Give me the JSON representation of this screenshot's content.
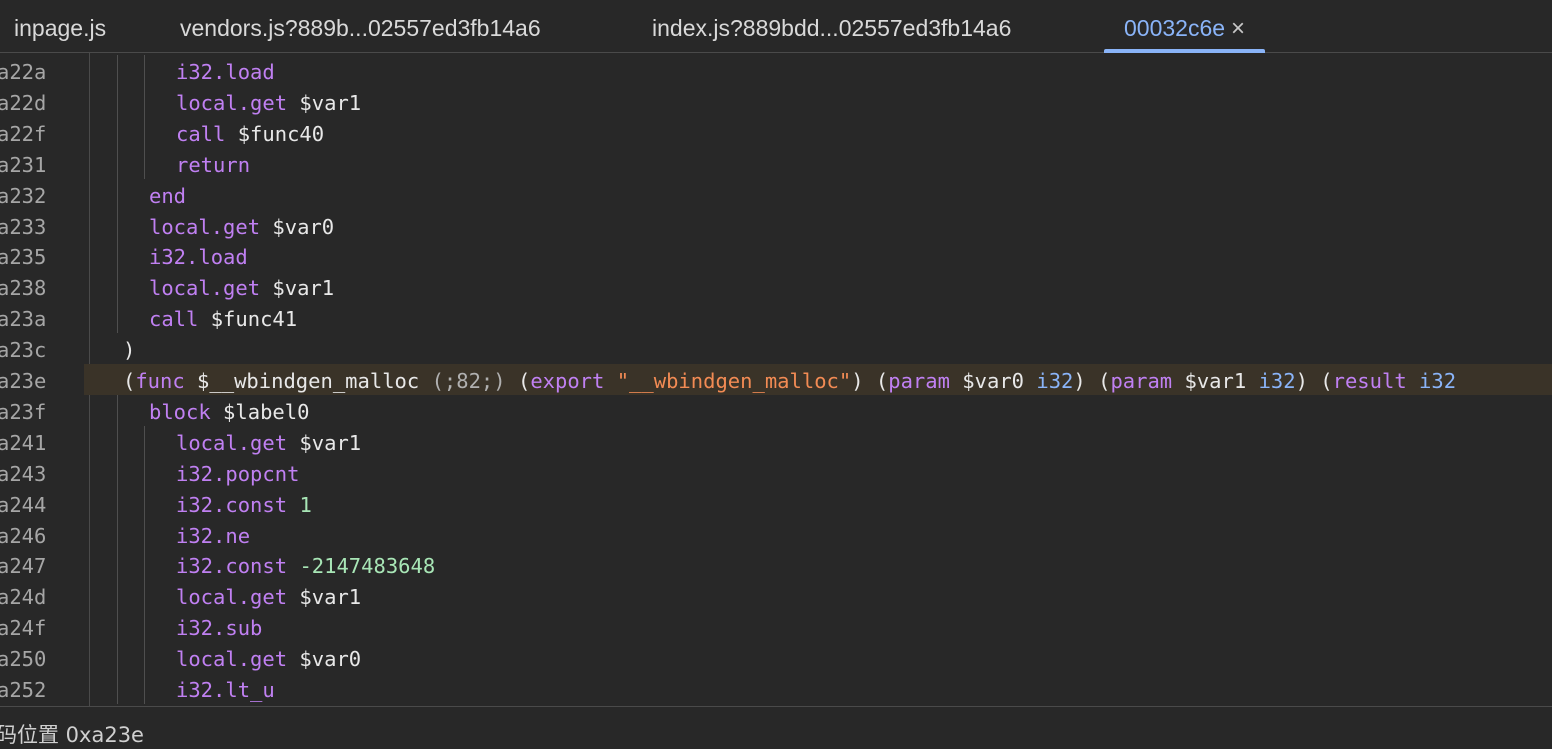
{
  "tabs": [
    {
      "label": "inpage.js",
      "active": false
    },
    {
      "label": "vendors.js?889b...02557ed3fb14a6",
      "active": false
    },
    {
      "label": "index.js?889bdd...02557ed3fb14a6",
      "active": false
    },
    {
      "label": "00032c6e",
      "active": true
    }
  ],
  "tab_close_icon": "×",
  "lines": [
    {
      "addr": "a22a",
      "tokens": [
        [
          "kw",
          "i32.load"
        ]
      ]
    },
    {
      "addr": "a22d",
      "tokens": [
        [
          "kw",
          "local.get"
        ],
        [
          "var",
          " $var1"
        ]
      ]
    },
    {
      "addr": "a22f",
      "tokens": [
        [
          "kw",
          "call"
        ],
        [
          "var",
          " $func40"
        ]
      ]
    },
    {
      "addr": "a231",
      "tokens": [
        [
          "kw",
          "return"
        ]
      ]
    },
    {
      "addr": "a232",
      "tokens": [
        [
          "kw",
          "end"
        ]
      ]
    },
    {
      "addr": "a233",
      "tokens": [
        [
          "kw",
          "local.get"
        ],
        [
          "var",
          " $var0"
        ]
      ]
    },
    {
      "addr": "a235",
      "tokens": [
        [
          "kw",
          "i32.load"
        ]
      ]
    },
    {
      "addr": "a238",
      "tokens": [
        [
          "kw",
          "local.get"
        ],
        [
          "var",
          " $var1"
        ]
      ]
    },
    {
      "addr": "a23a",
      "tokens": [
        [
          "kw",
          "call"
        ],
        [
          "var",
          " $func41"
        ]
      ]
    },
    {
      "addr": "a23c",
      "tokens": [
        [
          "punc",
          ")"
        ]
      ]
    },
    {
      "addr": "a23e",
      "tokens": [
        [
          "punc",
          "("
        ],
        [
          "kw",
          "func"
        ],
        [
          "var",
          " $__wbindgen_malloc "
        ],
        [
          "cmt",
          "(;82;)"
        ],
        [
          "punc",
          " ("
        ],
        [
          "kw",
          "export"
        ],
        [
          "punc",
          " "
        ],
        [
          "str",
          "\"__wbindgen_malloc\""
        ],
        [
          "punc",
          ") ("
        ],
        [
          "kw",
          "param"
        ],
        [
          "var",
          " $var0 "
        ],
        [
          "type",
          "i32"
        ],
        [
          "punc",
          ") ("
        ],
        [
          "kw",
          "param"
        ],
        [
          "var",
          " $var1 "
        ],
        [
          "type",
          "i32"
        ],
        [
          "punc",
          ") ("
        ],
        [
          "kw",
          "result"
        ],
        [
          "punc",
          " "
        ],
        [
          "type",
          "i32"
        ]
      ]
    },
    {
      "addr": "a23f",
      "tokens": [
        [
          "kw",
          "block"
        ],
        [
          "var",
          " $label0"
        ]
      ]
    },
    {
      "addr": "a241",
      "tokens": [
        [
          "kw",
          "local.get"
        ],
        [
          "var",
          " $var1"
        ]
      ]
    },
    {
      "addr": "a243",
      "tokens": [
        [
          "kw",
          "i32.popcnt"
        ]
      ]
    },
    {
      "addr": "a244",
      "tokens": [
        [
          "kw",
          "i32.const"
        ],
        [
          "punc",
          " "
        ],
        [
          "num",
          "1"
        ]
      ]
    },
    {
      "addr": "a246",
      "tokens": [
        [
          "kw",
          "i32.ne"
        ]
      ]
    },
    {
      "addr": "a247",
      "tokens": [
        [
          "kw",
          "i32.const"
        ],
        [
          "punc",
          " "
        ],
        [
          "num",
          "-2147483648"
        ]
      ]
    },
    {
      "addr": "a24d",
      "tokens": [
        [
          "kw",
          "local.get"
        ],
        [
          "var",
          " $var1"
        ]
      ]
    },
    {
      "addr": "a24f",
      "tokens": [
        [
          "kw",
          "i32.sub"
        ]
      ]
    },
    {
      "addr": "a250",
      "tokens": [
        [
          "kw",
          "local.get"
        ],
        [
          "var",
          " $var0"
        ]
      ]
    },
    {
      "addr": "a252",
      "tokens": [
        [
          "kw",
          "i32.lt_u"
        ]
      ]
    }
  ],
  "highlighted_line": "a23e",
  "status": {
    "text": "码位置 0xa23e"
  }
}
